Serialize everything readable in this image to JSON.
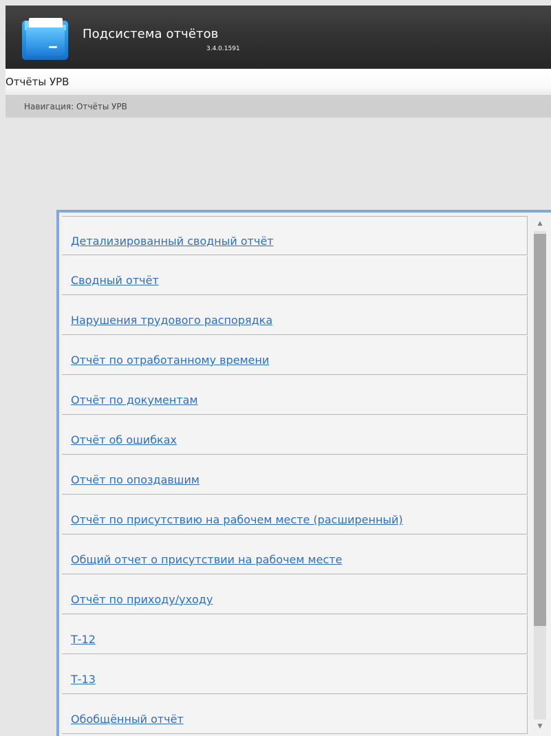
{
  "header": {
    "title": "Подсистема отчётов",
    "version": "3.4.0.1591"
  },
  "section": {
    "title": "Отчёты УРВ"
  },
  "navigation": {
    "label": "Навигация: Отчёты УРВ"
  },
  "reports": [
    {
      "label": "Детализированный сводный отчёт"
    },
    {
      "label": "Сводный отчёт"
    },
    {
      "label": "Нарушения трудового распорядка"
    },
    {
      "label": "Отчёт по отработанному времени"
    },
    {
      "label": "Отчёт по документам"
    },
    {
      "label": "Отчёт об ошибках"
    },
    {
      "label": "Отчёт по опоздавшим"
    },
    {
      "label": "Отчёт по присутствию на рабочем месте (расширенный)"
    },
    {
      "label": "Общий отчет о присутствии на рабочем месте"
    },
    {
      "label": "Отчёт по приходу/уходу"
    },
    {
      "label": "Т-12"
    },
    {
      "label": "Т-13"
    },
    {
      "label": "Обобщённый отчёт"
    }
  ],
  "colors": {
    "accent": "#7fa8dc",
    "link": "#2f6fb6",
    "header": "#333333"
  },
  "icons": {
    "app": "folder-icon",
    "scroll_up": "triangle-up-icon",
    "scroll_down": "triangle-down-icon"
  }
}
